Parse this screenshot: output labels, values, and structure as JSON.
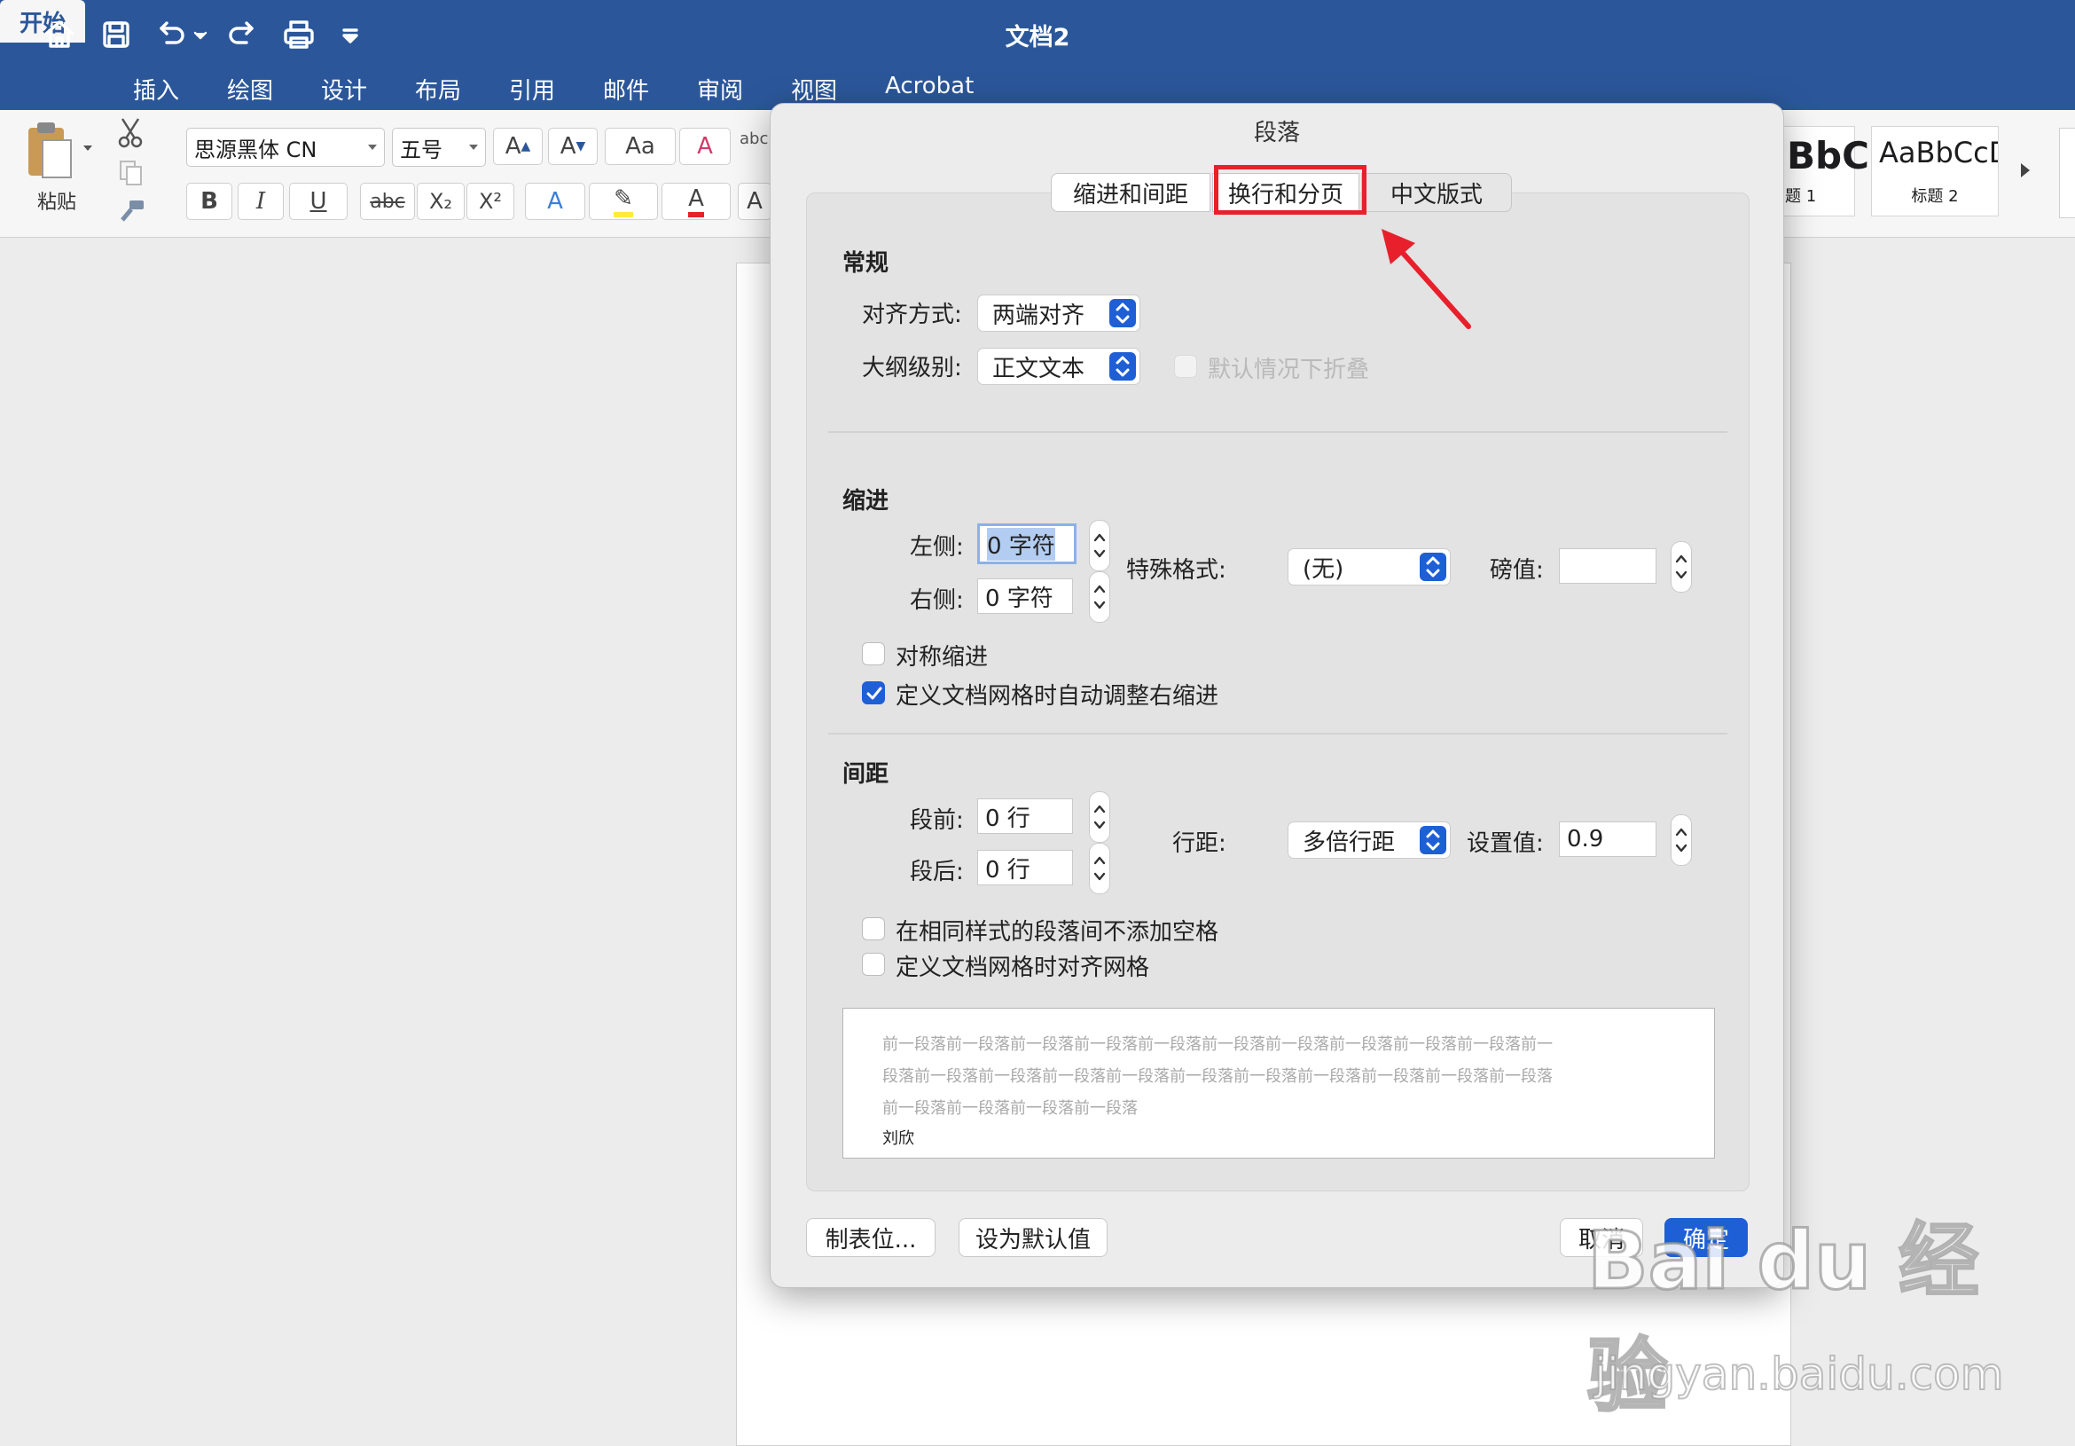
{
  "window": {
    "title": "文档2"
  },
  "quick_access": {
    "icons": [
      "home-icon",
      "save-icon",
      "undo-icon",
      "redo-icon",
      "print-icon",
      "customize-icon"
    ]
  },
  "ribbon_tabs": [
    "开始",
    "插入",
    "绘图",
    "设计",
    "布局",
    "引用",
    "邮件",
    "审阅",
    "视图",
    "Acrobat"
  ],
  "ribbon": {
    "paste_label": "粘贴",
    "font_name": "思源黑体 CN",
    "font_size": "五号",
    "bold": "B",
    "italic": "I",
    "underline": "U",
    "strike": "abc",
    "subscript": "X₂",
    "superscript": "X²",
    "styles": [
      {
        "preview": "BbC",
        "name": "题 1"
      },
      {
        "preview": "AaBbCcD",
        "name": "标题 2"
      }
    ]
  },
  "dialog": {
    "title": "段落",
    "tabs": [
      "缩进和间距",
      "换行和分页",
      "中文版式"
    ],
    "general": {
      "heading": "常规",
      "alignment_label": "对齐方式:",
      "alignment_value": "两端对齐",
      "outline_label": "大纲级别:",
      "outline_value": "正文文本",
      "collapse_label": "默认情况下折叠"
    },
    "indent": {
      "heading": "缩进",
      "left_label": "左侧:",
      "left_value": "0 字符",
      "right_label": "右侧:",
      "right_value": "0 字符",
      "special_label": "特殊格式:",
      "special_value": "(无)",
      "by_label": "磅值:",
      "by_value": "",
      "mirror_label": "对称缩进",
      "mirror_checked": false,
      "auto_adjust_label": "定义文档网格时自动调整右缩进",
      "auto_adjust_checked": true
    },
    "spacing": {
      "heading": "间距",
      "before_label": "段前:",
      "before_value": "0 行",
      "after_label": "段后:",
      "after_value": "0 行",
      "line_label": "行距:",
      "line_value": "多倍行距",
      "at_label": "设置值:",
      "at_value": "0.9",
      "no_space_label": "在相同样式的段落间不添加空格",
      "snap_grid_label": "定义文档网格时对齐网格"
    },
    "preview": {
      "line1": "前一段落前一段落前一段落前一段落前一段落前一段落前一段落前一段落前一段落前一段落前一",
      "line2": "段落前一段落前一段落前一段落前一段落前一段落前一段落前一段落前一段落前一段落前一段落",
      "line3": "前一段落前一段落前一段落前一段落",
      "sample": "刘欣"
    },
    "buttons": {
      "tabs": "制表位...",
      "default": "设为默认值",
      "cancel": "取消",
      "ok": "确定"
    }
  },
  "annotation": {
    "color": "#e8202c"
  },
  "watermark": {
    "logo": "Bai du 经验",
    "url": "jingyan.baidu.com"
  },
  "colors": {
    "title_bar": "#2b579a",
    "accent": "#1f5fd6"
  }
}
